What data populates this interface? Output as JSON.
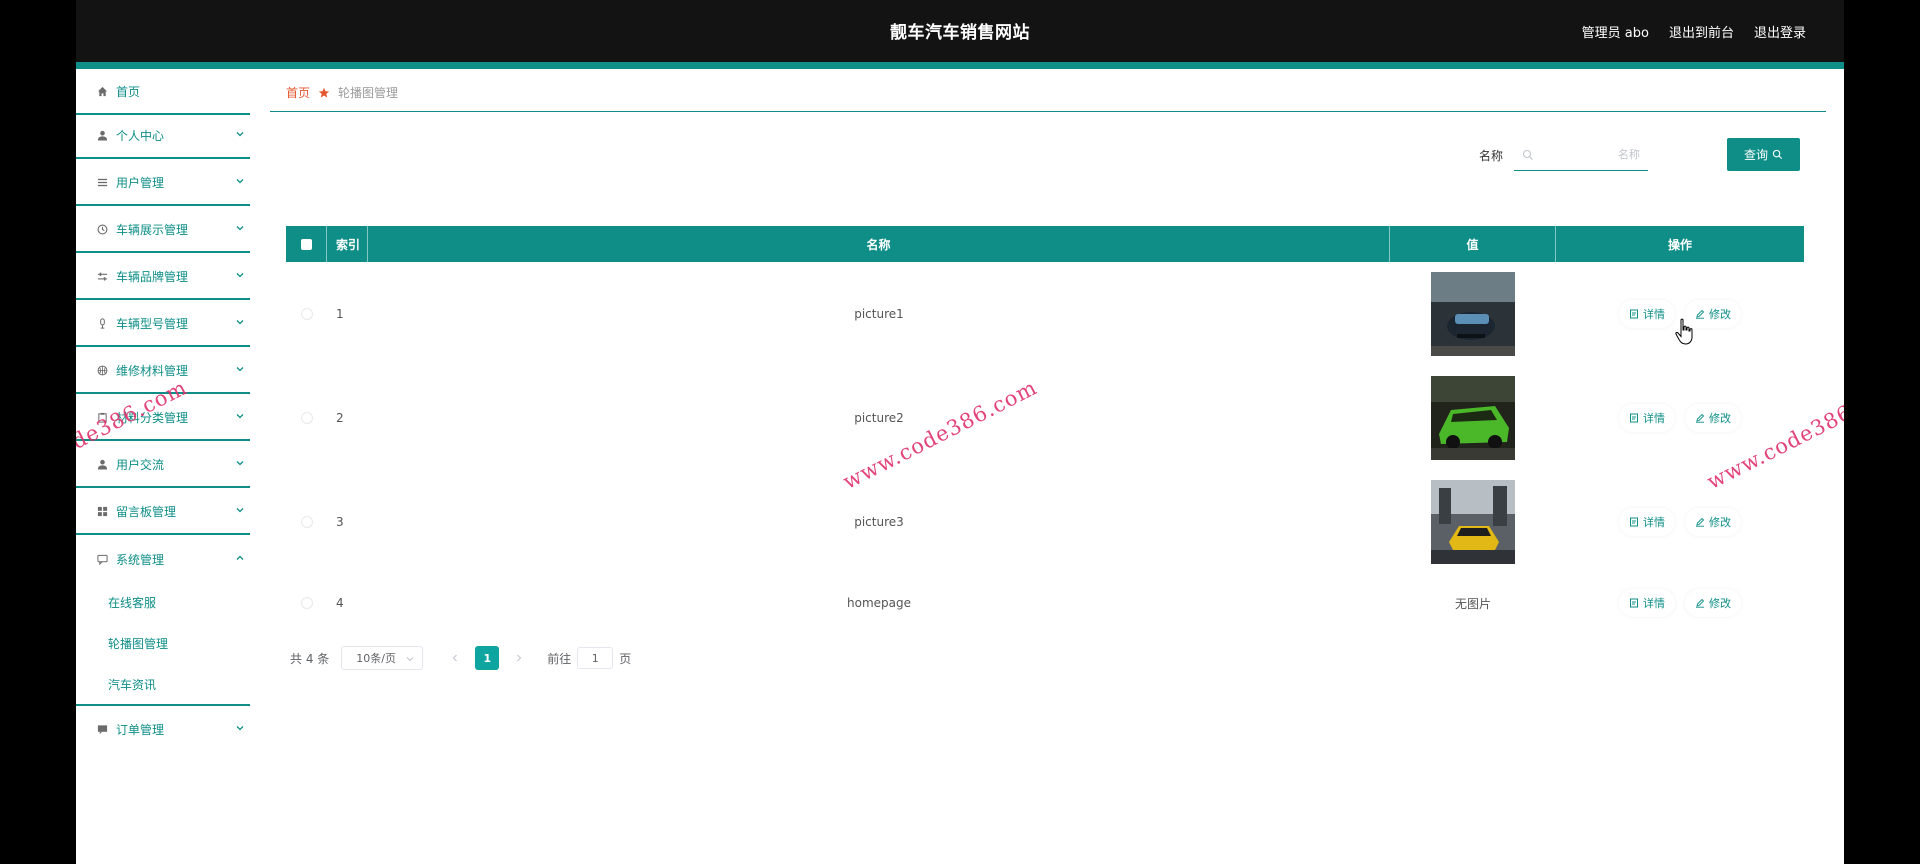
{
  "header": {
    "site_title": "靓车汽车销售网站",
    "admin_label": "管理员 abo",
    "back_front": "退出到前台",
    "logout": "退出登录"
  },
  "sidebar": {
    "items": [
      {
        "label": "首页",
        "icon": "home-icon"
      },
      {
        "label": "个人中心",
        "icon": "user-icon"
      },
      {
        "label": "用户管理",
        "icon": "list-icon"
      },
      {
        "label": "车辆展示管理",
        "icon": "clock-icon"
      },
      {
        "label": "车辆品牌管理",
        "icon": "sliders-icon"
      },
      {
        "label": "车辆型号管理",
        "icon": "mic-icon"
      },
      {
        "label": "维修材料管理",
        "icon": "basketball-icon"
      },
      {
        "label": "材料分类管理",
        "icon": "clipboard-icon"
      },
      {
        "label": "用户交流",
        "icon": "user-icon"
      },
      {
        "label": "留言板管理",
        "icon": "grid-icon"
      },
      {
        "label": "系统管理",
        "icon": "chat-icon"
      },
      {
        "label": "订单管理",
        "icon": "message-icon"
      }
    ],
    "system_sub": [
      "在线客服",
      "轮播图管理",
      "汽车资讯"
    ]
  },
  "breadcrumb": {
    "home": "首页",
    "current": "轮播图管理"
  },
  "search": {
    "label": "名称",
    "placeholder": "名称",
    "button": "查询"
  },
  "table": {
    "headers": {
      "index": "索引",
      "name": "名称",
      "value": "值",
      "action": "操作"
    },
    "rows": [
      {
        "index": "1",
        "name": "picture1",
        "value": "image"
      },
      {
        "index": "2",
        "name": "picture2",
        "value": "image"
      },
      {
        "index": "3",
        "name": "picture3",
        "value": "image"
      },
      {
        "index": "4",
        "name": "homepage",
        "value": "无图片"
      }
    ],
    "detail_label": "详情",
    "edit_label": "修改"
  },
  "pagination": {
    "total": "共 4 条",
    "page_size": "10条/页",
    "current_page": "1",
    "goto_prefix": "前往",
    "goto_value": "1",
    "goto_suffix": "页"
  },
  "watermark": "www.code386.com",
  "colors": {
    "accent": "#0e8e87",
    "header_bg": "#131313",
    "breadcrumb_home": "#e4572e",
    "watermark": "#e0306a"
  }
}
